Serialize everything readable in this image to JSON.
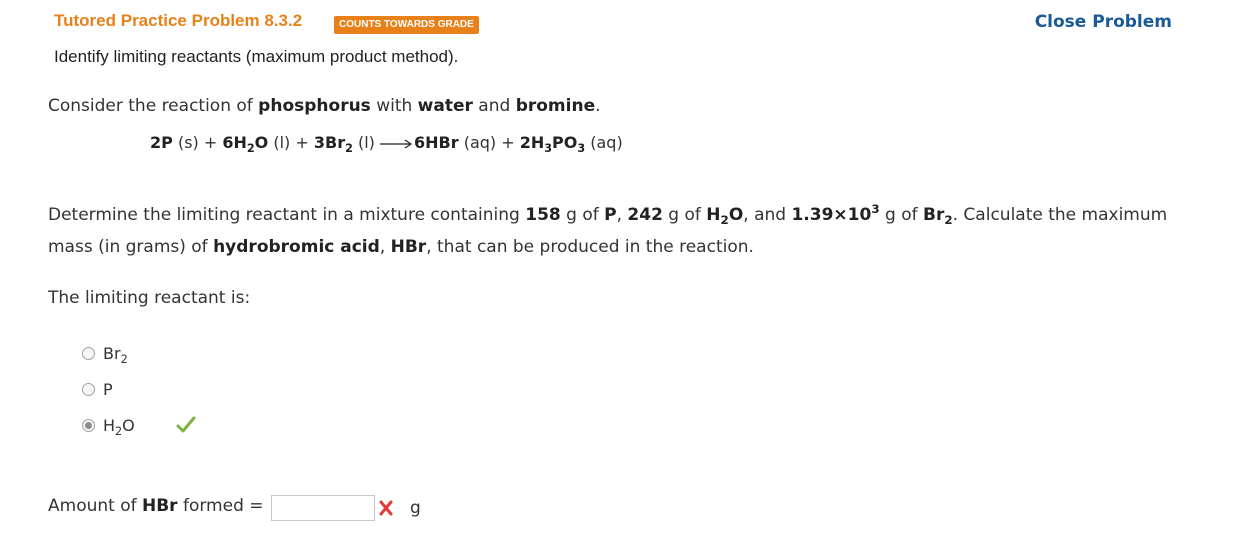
{
  "header": {
    "title": "Tutored Practice Problem 8.3.2",
    "badge": "COUNTS TOWARDS GRADE",
    "close": "Close Problem"
  },
  "subtitle": "Identify limiting reactants (maximum product method).",
  "intro": {
    "t1": "Consider the reaction of ",
    "b1": "phosphorus",
    "t2": " with ",
    "b2": "water",
    "t3": " and ",
    "b3": "bromine",
    "t4": "."
  },
  "equation": {
    "r1": "2P",
    "r1s": " (s) + ",
    "r2a": "6H",
    "r2sub": "2",
    "r2b": "O",
    "r2s": " (l) + ",
    "r3a": "3Br",
    "r3sub": "2",
    "r3s": " (l) ",
    "p1": "6HBr",
    "p1s": " (aq) + ",
    "p2a": "2H",
    "p2sub1": "3",
    "p2b": "PO",
    "p2sub2": "3",
    "p2s": " (aq)"
  },
  "question": {
    "t1": "Determine the limiting reactant in a mixture containing ",
    "m1": "158",
    "t2": " g of ",
    "e1": "P",
    "t3": ", ",
    "m2": "242",
    "t4": " g of ",
    "e2a": "H",
    "e2sub": "2",
    "e2b": "O",
    "t5": ", and ",
    "m3a": "1.39×10",
    "m3sup": "3",
    "t6": " g of ",
    "e3a": "Br",
    "e3sub": "2",
    "t7": ". Calculate the maximum",
    "t8": "mass (in grams) of ",
    "b1": "hydrobromic acid",
    "t9": ", ",
    "b2": "HBr",
    "t10": ", that can be produced in the reaction."
  },
  "limiting_prompt": "The limiting reactant is:",
  "options": [
    {
      "a": "Br",
      "sub": "2",
      "b": "",
      "checked": false
    },
    {
      "a": "P",
      "sub": "",
      "b": "",
      "checked": false
    },
    {
      "a": "H",
      "sub": "2",
      "b": "O",
      "checked": true
    }
  ],
  "amount": {
    "t1": "Amount of ",
    "b1": "HBr",
    "t2": " formed =",
    "value": "",
    "unit": "g"
  },
  "colors": {
    "accent": "#e8811a",
    "link": "#1a5a96",
    "correct": "#7cb342",
    "incorrect": "#e53935"
  },
  "icons": {
    "correct": "check-icon",
    "incorrect": "x-icon"
  }
}
